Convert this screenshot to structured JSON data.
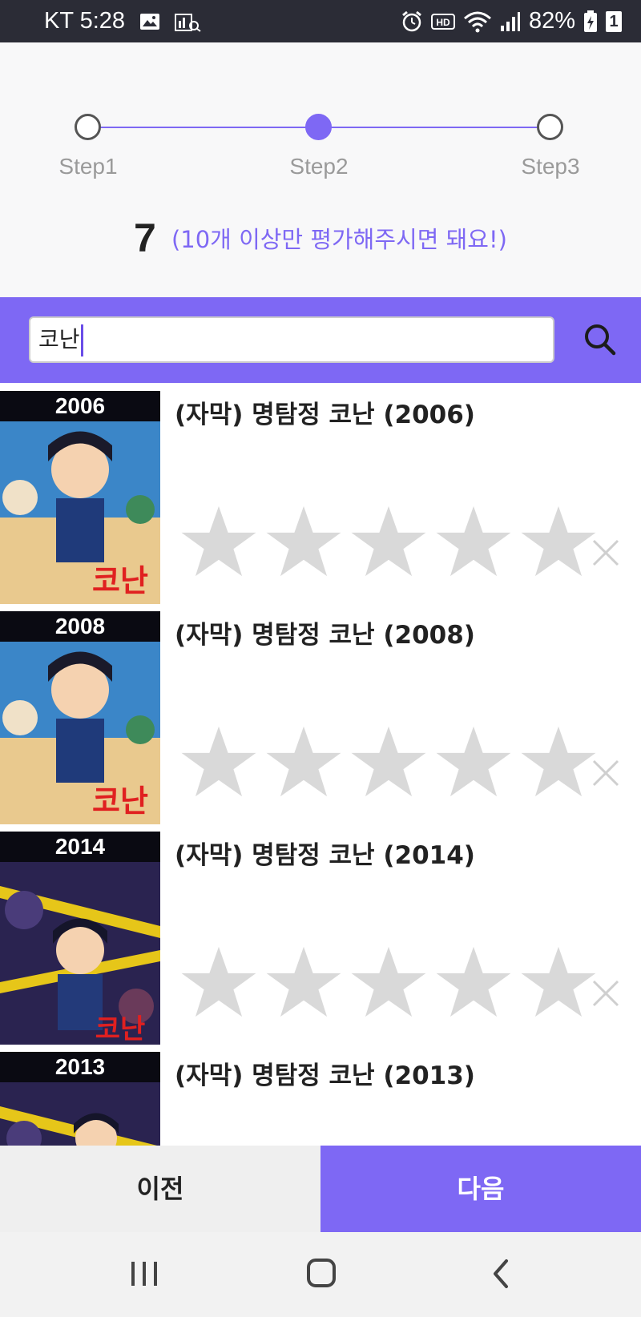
{
  "status_bar": {
    "carrier_time": "KT 5:28",
    "battery": "82%",
    "sim_badge": "1"
  },
  "steps": {
    "labels": [
      "Step1",
      "Step2",
      "Step3"
    ],
    "active_index": 1
  },
  "counter": {
    "count": "7",
    "hint": "(10개 이상만 평가해주시면 돼요!)"
  },
  "search": {
    "value": "코난",
    "icon": "search-icon"
  },
  "items": [
    {
      "year": "2006",
      "title": "(자막) 명탐정 코난 (2006)",
      "rating": 0,
      "max_rating": 5
    },
    {
      "year": "2008",
      "title": "(자막) 명탐정 코난 (2008)",
      "rating": 0,
      "max_rating": 5
    },
    {
      "year": "2014",
      "title": "(자막) 명탐정 코난 (2014)",
      "rating": 0,
      "max_rating": 5
    },
    {
      "year": "2013",
      "title": "(자막) 명탐정 코난 (2013)",
      "rating": 0,
      "max_rating": 5
    }
  ],
  "buttons": {
    "prev": "이전",
    "next": "다음"
  },
  "colors": {
    "accent": "#7e68f4",
    "star_empty": "#d9d9d9",
    "status_bar": "#2b2c36"
  }
}
